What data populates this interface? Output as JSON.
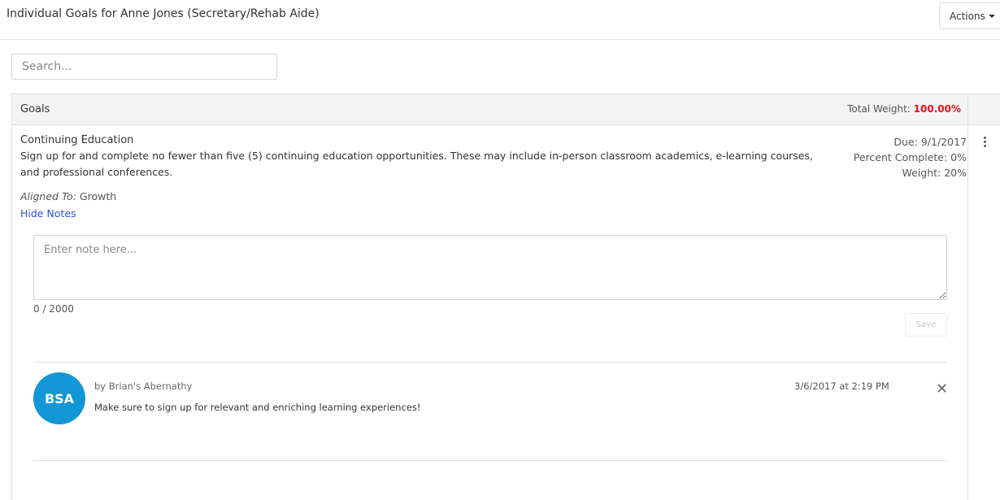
{
  "header": {
    "title": "Individual Goals for Anne Jones (Secretary/Rehab Aide)",
    "actions_label": "Actions"
  },
  "search": {
    "placeholder": "Search..."
  },
  "goals_panel": {
    "heading": "Goals",
    "total_weight_label": "Total Weight:",
    "total_weight_value": "100.00%",
    "total_weight_color": "#e8111a"
  },
  "goal": {
    "name": "Continuing Education",
    "description": "Sign up for and complete no fewer than five (5) continuing education opportunities. These may include in-person classroom academics, e-learning courses, and professional conferences.",
    "due": "Due: 9/1/2017",
    "percent_complete": "Percent Complete: 0%",
    "weight": "Weight: 20%",
    "aligned_label": "Aligned To:",
    "aligned_value": "Growth",
    "hide_notes_label": "Hide Notes",
    "menu_icon": "kebab-menu-icon"
  },
  "note_editor": {
    "placeholder": "Enter note here...",
    "counter": "0 / 2000",
    "save_label": "Save"
  },
  "notes": [
    {
      "avatar_initials": "BSA",
      "avatar_color": "#1196d6",
      "author": "by Brian's Abernathy",
      "text": "Make sure to sign up for relevant and enriching learning experiences!",
      "timestamp": "3/6/2017 at 2:19 PM",
      "delete_icon": "close-icon"
    }
  ]
}
